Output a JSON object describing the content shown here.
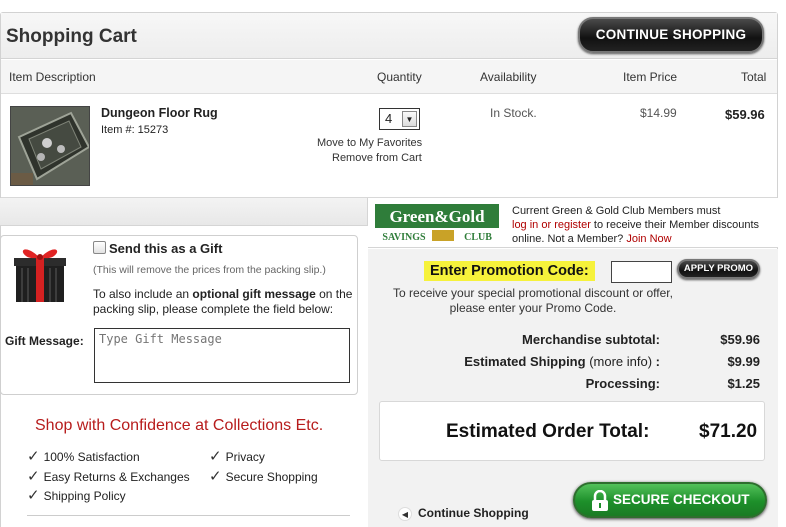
{
  "header": {
    "title": "Shopping Cart",
    "continue_label": "CONTINUE SHOPPING"
  },
  "columns": {
    "description": "Item Description",
    "quantity": "Quantity",
    "availability": "Availability",
    "price": "Item Price",
    "total": "Total"
  },
  "item": {
    "name": "Dungeon Floor Rug",
    "number_label": "Item #:  15273",
    "quantity": "4",
    "move_favorites": "Move to My Favorites",
    "remove": "Remove from Cart",
    "availability": "In Stock.",
    "price": "$14.99",
    "total": "$59.96"
  },
  "gift": {
    "title": "Send this as a Gift",
    "note": "(This will remove the prices from the packing slip.)",
    "desc_prefix": "To also include an ",
    "desc_bold": "optional gift message",
    "desc_suffix": " on the packing slip, please complete the field below:",
    "message_label": "Gift Message:",
    "message_placeholder": "Type Gift Message"
  },
  "confidence": {
    "title": "Shop with Confidence at Collections Etc.",
    "items": [
      "100% Satisfaction",
      "Easy Returns & Exchanges",
      "Shipping Policy",
      "Privacy",
      "Secure Shopping"
    ]
  },
  "club": {
    "logo_top": "Green&Gold",
    "logo_savings": "SAVINGS",
    "logo_club": "CLUB",
    "line1": "Current Green & Gold Club Members must",
    "login_link": "log in or register",
    "line2_suffix": " to receive their Member discounts",
    "line3_prefix": "online. Not a Member? ",
    "join_link": "Join Now"
  },
  "promo": {
    "label": "Enter Promotion Code:",
    "apply_label": "APPLY PROMO",
    "desc": "To receive your special promotional discount or offer, please enter your Promo Code."
  },
  "summary": {
    "merch_label": "Merchandise subtotal:",
    "merch_value": "$59.96",
    "shipping_label": "Estimated Shipping ",
    "shipping_more": "(more info)",
    "shipping_colon": " :",
    "shipping_value": "$9.99",
    "processing_label": "Processing:",
    "processing_value": "$1.25",
    "total_label": "Estimated Order Total:",
    "total_value": "$71.20"
  },
  "footer": {
    "continue_label": "Continue Shopping",
    "checkout_label": "SECURE CHECKOUT"
  },
  "colors": {
    "brand_red": "#b71c1c",
    "checkout_green": "#1d8f2a",
    "highlight_yellow": "#f6f23b"
  }
}
